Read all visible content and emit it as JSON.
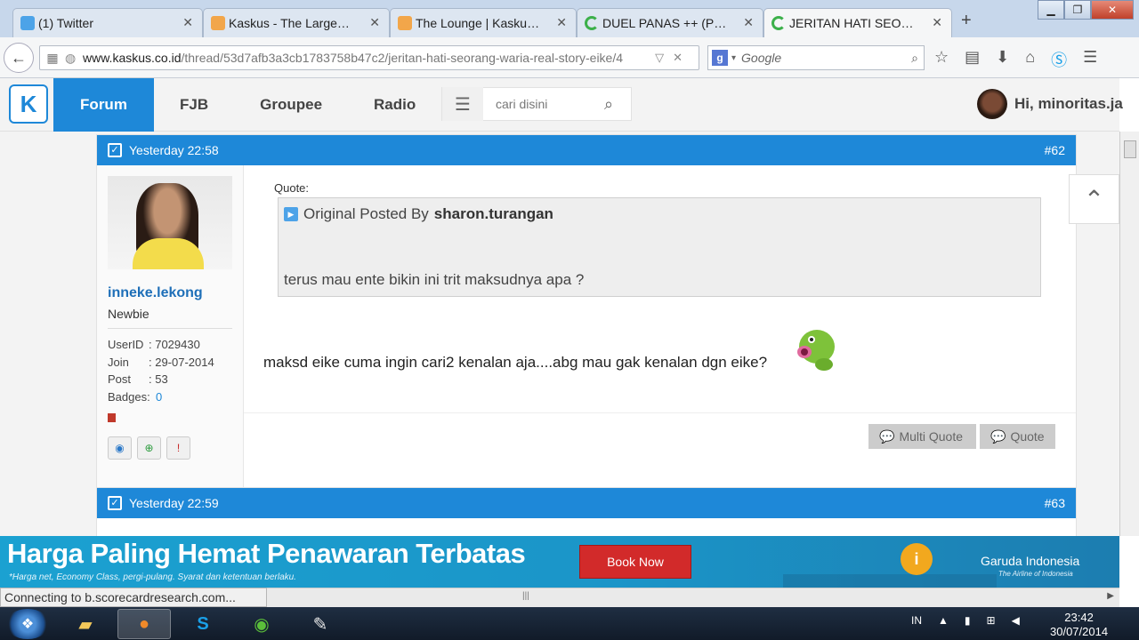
{
  "browser": {
    "tabs": [
      {
        "label": "(1) Twitter",
        "icon": "twitter-icon",
        "color": "#4ca3e8"
      },
      {
        "label": "Kaskus - The Largest ...",
        "icon": "kaskus-icon",
        "color": "#f2a64a"
      },
      {
        "label": "The Lounge | Kaskus ...",
        "icon": "kaskus-icon",
        "color": "#f2a64a"
      },
      {
        "label": "DUEL PANAS ++ (PE...",
        "icon": "loading-icon",
        "color": "#3cb04a"
      },
      {
        "label": "JERITAN HATI SEOR...",
        "icon": "loading-icon",
        "color": "#3cb04a"
      }
    ],
    "new_tab": "+",
    "url_domain": "www.kaskus.co.id",
    "url_path": "/thread/53d7afb3a3cb1783758b47c2/jeritan-hati-seorang-waria-real-story-eike/4",
    "search_placeholder": "Google"
  },
  "site": {
    "logo": "K",
    "nav": [
      "Forum",
      "FJB",
      "Groupee",
      "Radio"
    ],
    "search_placeholder": "cari disini",
    "greeting": "Hi, minoritas.ja"
  },
  "posts": [
    {
      "time": "Yesterday 22:58",
      "number": "#62",
      "user": {
        "name": "inneke.lekong",
        "rank": "Newbie",
        "userid_label": "UserID",
        "userid": ": 7029430",
        "join_label": "Join",
        "join": ": 29-07-2014",
        "post_label": "Post",
        "post": ": 53",
        "badges_label": "Badges:",
        "badges": "0"
      },
      "quote_label": "Quote:",
      "quote_by_prefix": "Original Posted By",
      "quote_by": "sharon.turangan",
      "quote_text": "terus mau ente bikin ini trit maksudnya apa ?",
      "message": "maksd eike cuma ingin cari2 kenalan aja....abg mau gak kenalan dgn eike?",
      "multi_quote": "Multi Quote",
      "quote_btn": "Quote"
    },
    {
      "time": "Yesterday 22:59",
      "number": "#63"
    }
  ],
  "ad": {
    "headline": "Harga Paling Hemat Penawaran Terbatas",
    "sub": "*Harga net, Economy Class, pergi-pulang. Syarat dan ketentuan berlaku.",
    "cta": "Book Now",
    "brand": "Garuda Indonesia",
    "brand_sub": "The Airline of Indonesia"
  },
  "status_text": "Connecting to b.scorecardresearch.com...",
  "taskbar": {
    "lang": "IN",
    "time": "23:42",
    "date": "30/07/2014"
  },
  "colors": {
    "kaskus_blue": "#1e88d8",
    "ad_red": "#d22a2a"
  }
}
